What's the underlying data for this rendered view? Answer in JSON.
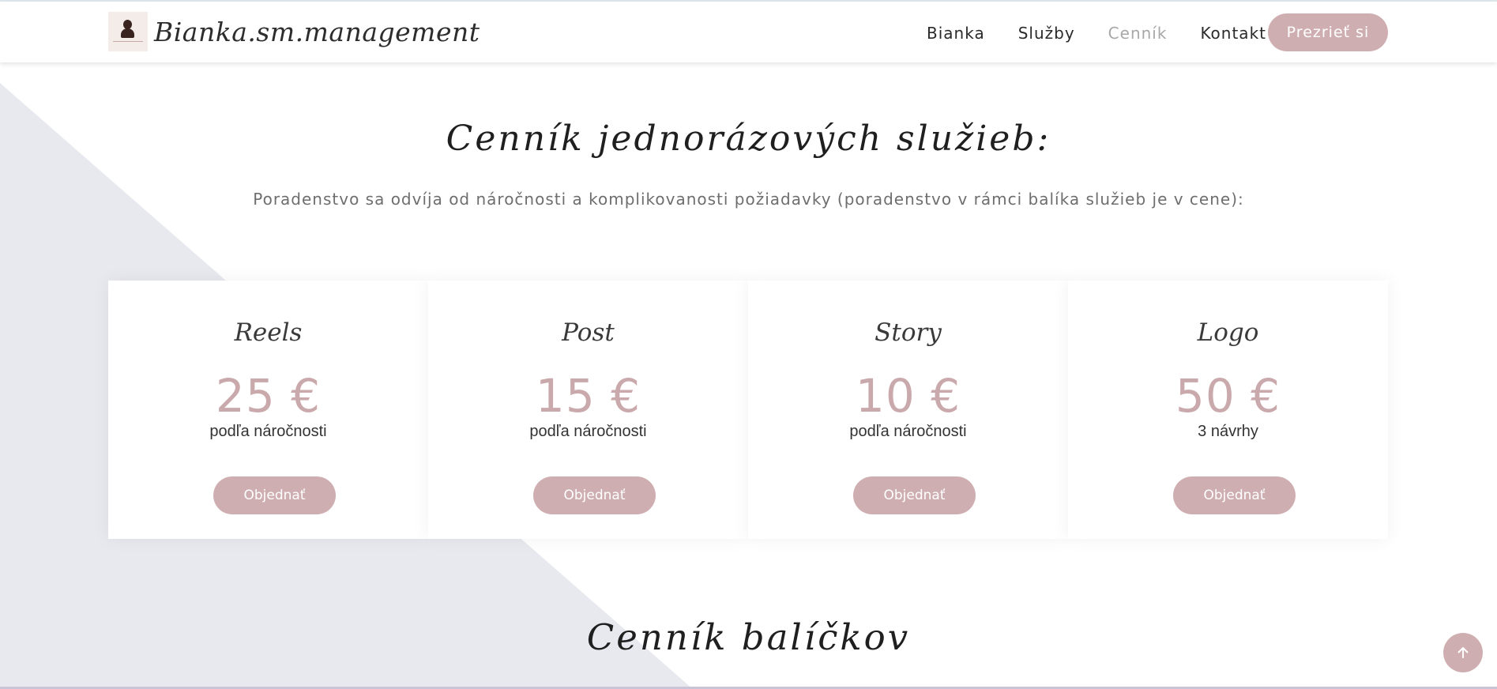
{
  "header": {
    "brand_name": "Bianka.sm.management",
    "nav": [
      {
        "label": "Bianka",
        "active": false
      },
      {
        "label": "Služby",
        "active": false
      },
      {
        "label": "Cenník",
        "active": true
      },
      {
        "label": "Kontakt",
        "active": false
      }
    ],
    "cta_label": "Prezrieť si"
  },
  "pricing": {
    "title": "Cenník jednorázových služieb:",
    "subtitle": "Poradenstvo sa odvíja od náročnosti a komplikovanosti požiadavky (poradenstvo v rámci balíka služieb je v cene):",
    "cards": [
      {
        "name": "Reels",
        "price": "25 €",
        "note": "podľa náročnosti",
        "button": "Objednať"
      },
      {
        "name": "Post",
        "price": "15 €",
        "note": "podľa náročnosti",
        "button": "Objednať"
      },
      {
        "name": "Story",
        "price": "10 €",
        "note": "podľa náročnosti",
        "button": "Objednať"
      },
      {
        "name": "Logo",
        "price": "50 €",
        "note": "3 návrhy",
        "button": "Objednať"
      }
    ]
  },
  "packages": {
    "title": "Cenník balíčkov"
  },
  "colors": {
    "accent": "#cfaeb1",
    "price": "#c9a9ab",
    "background_shape": "#e8e9ef",
    "nav_active": "#a8a8a8"
  },
  "icons": {
    "scroll_top": "arrow-up-icon"
  }
}
